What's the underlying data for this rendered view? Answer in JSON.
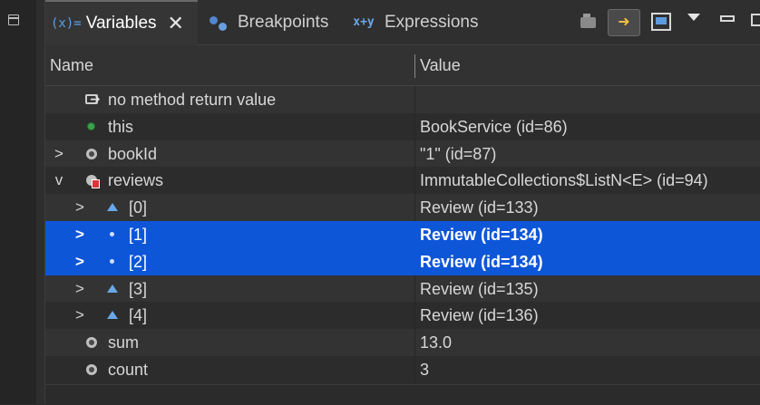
{
  "tabs": {
    "variables": {
      "icon_text": "(x)=",
      "label": "Variables",
      "close": "✕"
    },
    "breakpoints": {
      "label": "Breakpoints"
    },
    "expressions": {
      "label": "Expressions"
    }
  },
  "columns": {
    "name": "Name",
    "value": "Value"
  },
  "rows": [
    {
      "name": "no method return value",
      "value": "",
      "icon": "return-icon",
      "expander": ""
    },
    {
      "name": "this",
      "value": "BookService  (id=86)",
      "icon": "field-icon",
      "expander": ""
    },
    {
      "name": "bookId",
      "value": "\"1\" (id=87)",
      "icon": "local-variable-icon",
      "expander": ">"
    },
    {
      "name": "reviews",
      "value": "ImmutableCollections$ListN<E>  (id=94)",
      "icon": "list-variable-icon",
      "expander": "v"
    },
    {
      "name": "[0]",
      "value": "Review  (id=133)",
      "icon": "element-icon",
      "expander": ">"
    },
    {
      "name": "[1]",
      "value": "Review  (id=134)",
      "icon": "element-icon",
      "expander": ">",
      "selected": true
    },
    {
      "name": "[2]",
      "value": "Review  (id=134)",
      "icon": "element-icon",
      "expander": ">",
      "selected": true
    },
    {
      "name": "[3]",
      "value": "Review  (id=135)",
      "icon": "element-icon",
      "expander": ">"
    },
    {
      "name": "[4]",
      "value": "Review  (id=136)",
      "icon": "element-icon",
      "expander": ">"
    },
    {
      "name": "sum",
      "value": "13.0",
      "icon": "local-variable-icon",
      "expander": ""
    },
    {
      "name": "count",
      "value": "3",
      "icon": "local-variable-icon",
      "expander": ""
    }
  ],
  "colors": {
    "selection": "#0e56d8",
    "accent": "#5aa0e6"
  }
}
